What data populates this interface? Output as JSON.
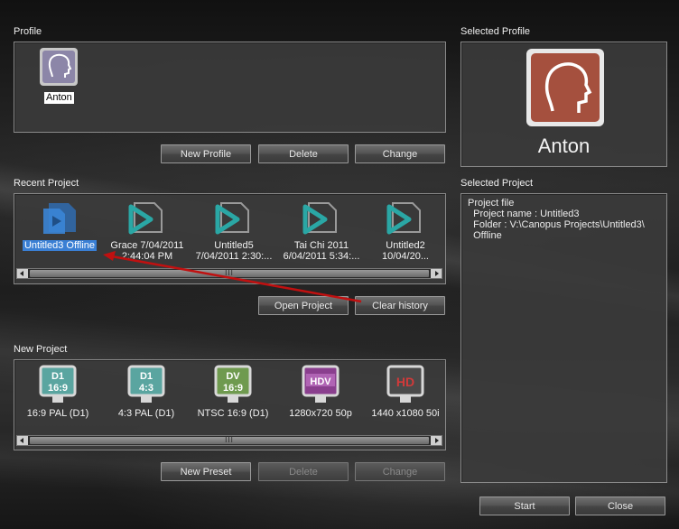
{
  "profile": {
    "section_label": "Profile",
    "items": [
      {
        "name": "Anton"
      }
    ],
    "buttons": {
      "new": "New Profile",
      "delete": "Delete",
      "change": "Change"
    }
  },
  "selected_profile": {
    "section_label": "Selected Profile",
    "name": "Anton"
  },
  "recent_project": {
    "section_label": "Recent Project",
    "items": [
      {
        "line1": "Untitled3 Offline",
        "line2": "",
        "selected": true,
        "icon": "offline-project-icon"
      },
      {
        "line1": "Grace 7/04/2011",
        "line2": "2:44:04 PM",
        "icon": "project-play-icon"
      },
      {
        "line1": "Untitled5",
        "line2": "7/04/2011 2:30:...",
        "icon": "project-play-icon"
      },
      {
        "line1": "Tai Chi 2011",
        "line2": "6/04/2011 5:34:...",
        "icon": "project-play-icon"
      },
      {
        "line1": "Untitled2",
        "line2": "10/04/20...",
        "icon": "project-play-icon"
      }
    ],
    "buttons": {
      "open": "Open Project",
      "clear": "Clear history"
    },
    "scroll_grip": "III"
  },
  "selected_project": {
    "section_label": "Selected Project",
    "details": "Project file\n  Project name : Untitled3\n  Folder : V:\\Canopus Projects\\Untitled3\\\n  Offline"
  },
  "new_project": {
    "section_label": "New Project",
    "items": [
      {
        "label": "16:9 PAL (D1)",
        "badge_top": "D1",
        "badge_bottom": "16:9",
        "color": "#5aa5a0"
      },
      {
        "label": "4:3 PAL (D1)",
        "badge_top": "D1",
        "badge_bottom": "4:3",
        "color": "#5aa5a0"
      },
      {
        "label": "NTSC 16:9 (D1)",
        "badge_top": "DV",
        "badge_bottom": "16:9",
        "color": "#6f9a4f"
      },
      {
        "label": "1280x720 50p",
        "badge_top": "HDV",
        "badge_bottom": "",
        "color": "#8a3f8e"
      },
      {
        "label": "1440 x1080 50i",
        "badge_top": "HD",
        "badge_bottom": "",
        "color": "#d23a3a"
      }
    ],
    "buttons": {
      "new": "New Preset",
      "delete": "Delete",
      "change": "Change"
    },
    "scroll_grip": "III"
  },
  "footer": {
    "start": "Start",
    "close": "Close"
  },
  "colors": {
    "accent": "#3a7fd4",
    "profile_tile": "#a5503e",
    "annotation_arrow": "#c01010"
  }
}
